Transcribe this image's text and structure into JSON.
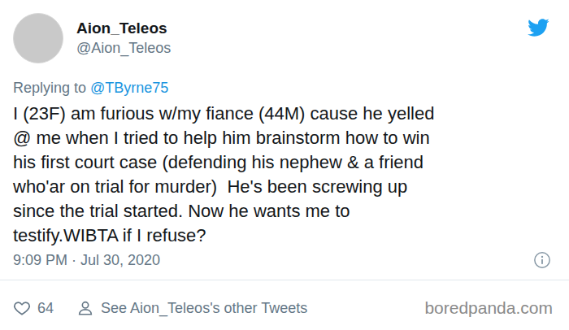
{
  "author": {
    "name": "Aion_Teleos",
    "handle": "@Aion_Teleos"
  },
  "reply": {
    "prefix": "Replying to",
    "target": "@TByrne75"
  },
  "tweet": {
    "lines": [
      "I (23F) am furious w/my fiance (44M) cause he yelled",
      "@ me when I tried to help him brainstorm how to win",
      "his first court case (defending his nephew & a friend",
      "who'ar on trial for murder)  He's been screwing up",
      "since the trial started. Now he wants me to",
      "testify.WIBTA if I refuse?"
    ]
  },
  "timestamp": "9:09 PM · Jul 30, 2020",
  "footer": {
    "likes": "64",
    "profile_link": "See Aion_Teleos's other Tweets"
  },
  "watermark": "boredpanda.com"
}
